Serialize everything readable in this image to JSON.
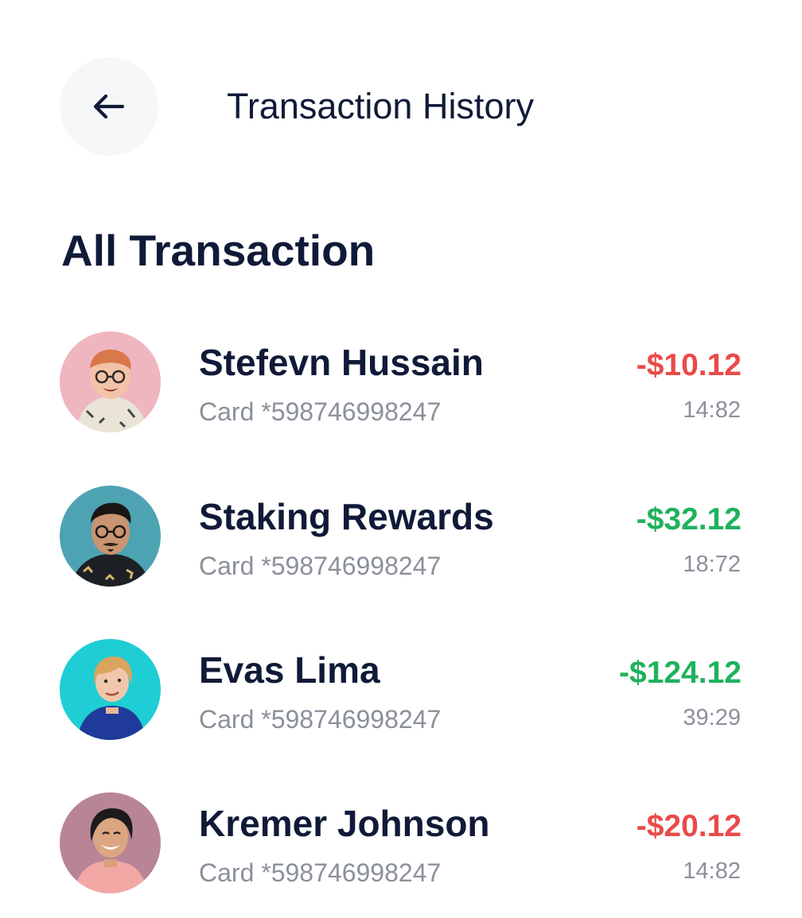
{
  "header": {
    "title": "Transaction History",
    "back_icon": "arrow-left-icon"
  },
  "section": {
    "title": "All Transaction"
  },
  "colors": {
    "debit": "#ea4a4a",
    "credit": "#1fb25d",
    "text_primary": "#101a38",
    "text_secondary": "#8b909b",
    "back_button_bg": "#f6f7f9"
  },
  "transactions": [
    {
      "name": "Stefevn Hussain",
      "card": "Card *598746998247",
      "amount": "-$10.12",
      "time": "14:82",
      "amount_color": "#ea4a4a",
      "avatar_bg": "#efb6c0"
    },
    {
      "name": "Staking Rewards",
      "card": "Card *598746998247",
      "amount": "-$32.12",
      "time": "18:72",
      "amount_color": "#1fb25d",
      "avatar_bg": "#4ea3b3"
    },
    {
      "name": "Evas Lima",
      "card": "Card *598746998247",
      "amount": "-$124.12",
      "time": "39:29",
      "amount_color": "#1fb25d",
      "avatar_bg": "#1fcdd4"
    },
    {
      "name": "Kremer Johnson",
      "card": "Card *598746998247",
      "amount": "-$20.12",
      "time": "14:82",
      "amount_color": "#ea4a4a",
      "avatar_bg": "#b88596"
    }
  ]
}
